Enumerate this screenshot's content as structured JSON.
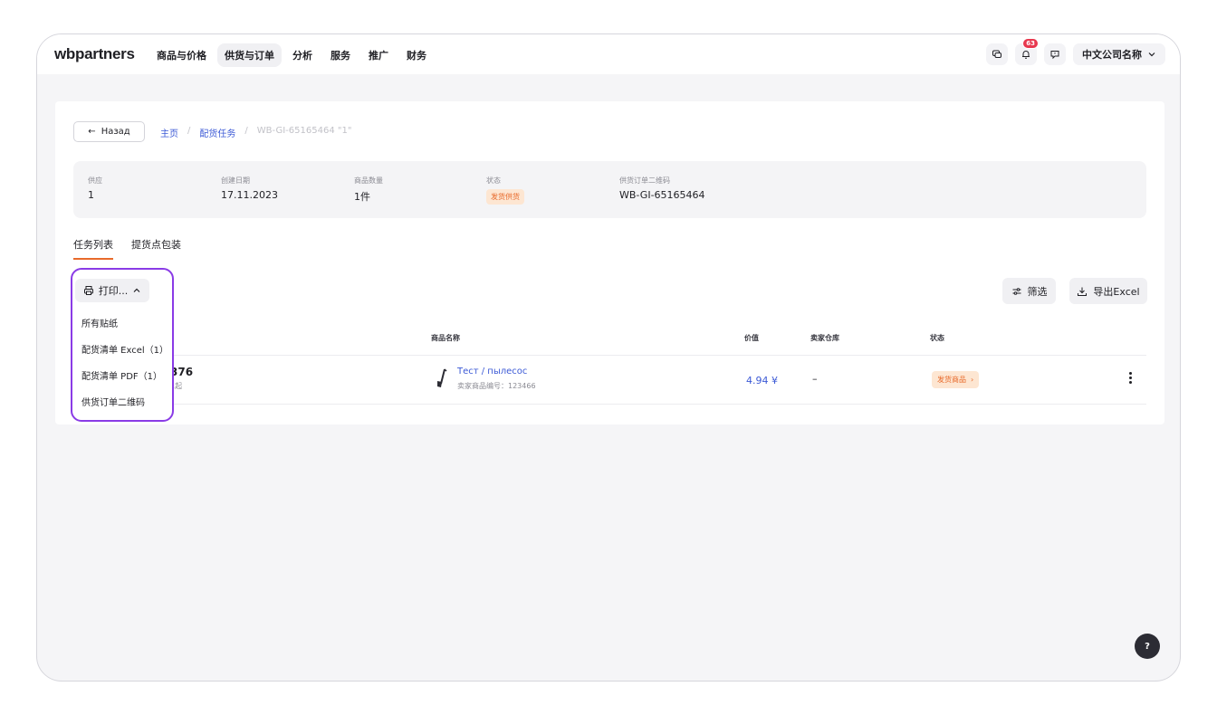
{
  "header": {
    "logo_wb": "wb",
    "logo_o": "",
    "logo_rest": "partners",
    "nav": [
      "商品与价格",
      "供货与订单",
      "分析",
      "服务",
      "推广",
      "财务"
    ],
    "active_nav": 1,
    "notification_count": "63",
    "company_name": "中文公司名称"
  },
  "breadcrumb": {
    "back_label": "Назад",
    "home": "主页",
    "tasks": "配货任务",
    "current": "WB-GI-65165464 \"1\""
  },
  "info": [
    {
      "label": "供应",
      "value": "1"
    },
    {
      "label": "创建日期",
      "value": "17.11.2023"
    },
    {
      "label": "商品数量",
      "value": "1件"
    },
    {
      "label": "状态",
      "value": "发货供货"
    },
    {
      "label": "供货订单二维码",
      "value": "WB-GI-65165464"
    }
  ],
  "tabs": [
    "任务列表",
    "提货点包装"
  ],
  "print_button": "打印...",
  "print_menu": [
    "所有贴纸",
    "配货清单 Excel（1）",
    "配货清单 PDF（1）",
    "供货订单二维码"
  ],
  "filter_label": "筛选",
  "export_label": "导出Excel",
  "table": {
    "headers": [
      "商品名称",
      "价值",
      "卖家仓库",
      "状态"
    ],
    "row": {
      "id": "376",
      "sub": "1起",
      "product_name": "Тест / пылесос",
      "product_sku": "卖家商品编号：123466",
      "price": "4.94 ¥",
      "warehouse": "–",
      "status": "发货商品"
    }
  },
  "help_label": "?"
}
